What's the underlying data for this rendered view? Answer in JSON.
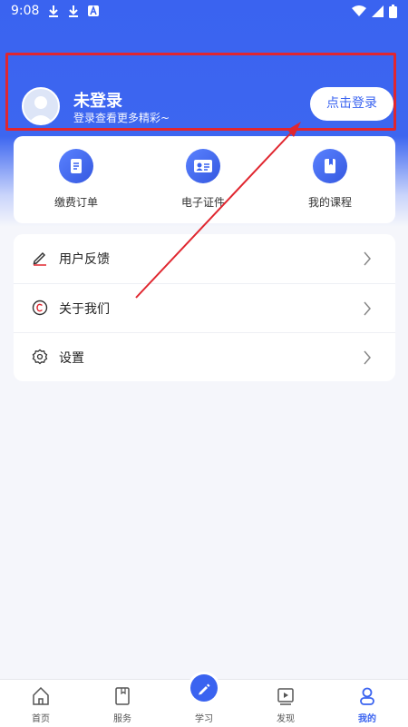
{
  "status_bar": {
    "time": "9:08"
  },
  "profile": {
    "name": "未登录",
    "subtitle": "登录查看更多精彩~",
    "login_button": "点击登录"
  },
  "quick_actions": [
    {
      "label": "缴费订单",
      "icon": "order-icon"
    },
    {
      "label": "电子证件",
      "icon": "id-card-icon"
    },
    {
      "label": "我的课程",
      "icon": "course-book-icon"
    }
  ],
  "menu": [
    {
      "label": "用户反馈",
      "icon": "pencil-icon"
    },
    {
      "label": "关于我们",
      "icon": "copyright-icon"
    },
    {
      "label": "设置",
      "icon": "gear-icon"
    }
  ],
  "bottom_nav": [
    {
      "label": "首页",
      "icon": "home-icon"
    },
    {
      "label": "服务",
      "icon": "book-icon"
    },
    {
      "label": "学习",
      "icon": "pen-icon"
    },
    {
      "label": "发现",
      "icon": "video-icon"
    },
    {
      "label": "我的",
      "icon": "profile-icon",
      "active": true
    }
  ],
  "colors": {
    "primary": "#3a63f0",
    "annotation": "#e0262f"
  }
}
